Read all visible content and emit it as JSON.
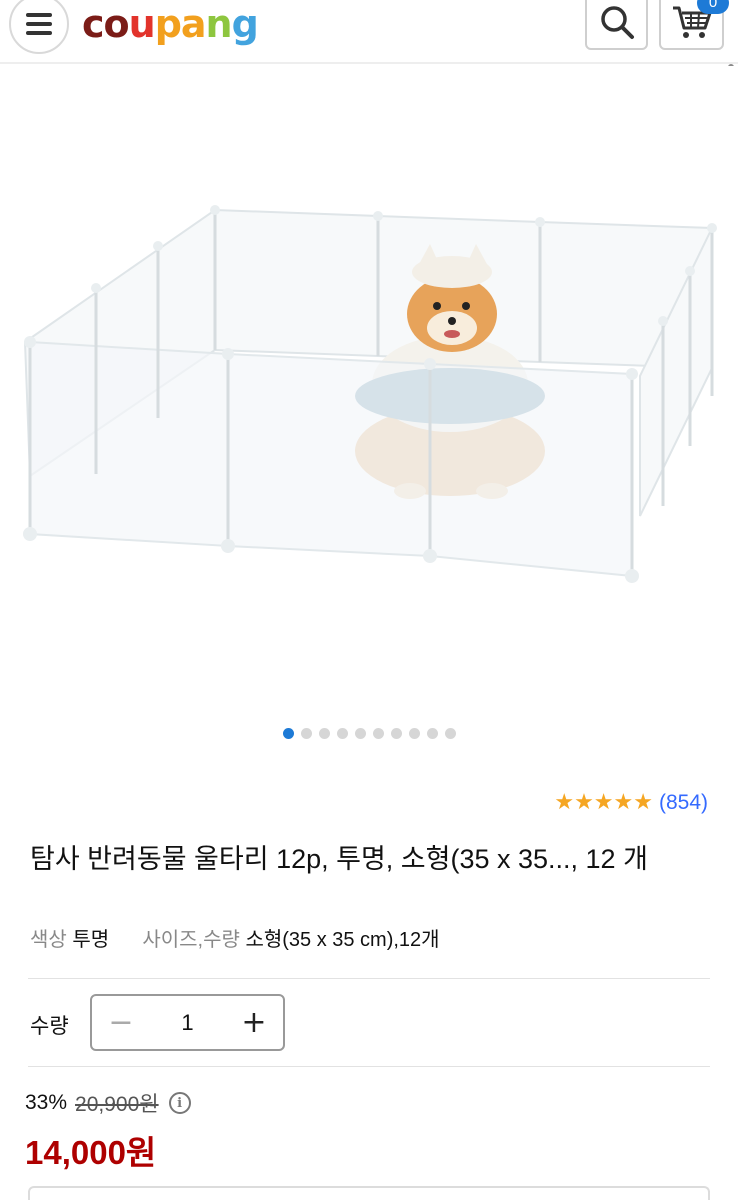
{
  "header": {
    "logo": {
      "c1": "co",
      "c2": "u",
      "c3": "pa",
      "c4": "n",
      "c5": "g"
    },
    "cart_badge": "0",
    "icons": [
      "menu-icon",
      "search-icon",
      "cart-icon"
    ]
  },
  "carousel": {
    "total": 10,
    "active_index": 0
  },
  "rating": {
    "stars": "★★★★★",
    "review_count": "(854)"
  },
  "product": {
    "title": "탐사 반려동물 울타리 12p, 투명, 소형(35 x 35..., 12 개",
    "options": [
      {
        "label": "색상",
        "value": "투명"
      },
      {
        "label": "사이즈,수량",
        "value": "소형(35 x 35 cm),12개"
      }
    ]
  },
  "quantity": {
    "label": "수량",
    "value": "1",
    "minus": "−",
    "plus": "+"
  },
  "price": {
    "discount": "33%",
    "original": "20,900원",
    "sale": "14,000원",
    "info_icon": "i"
  },
  "colors": {
    "accent": "#1d7ad6",
    "sale_price": "#ae0000",
    "star": "#f5a623",
    "review_link": "#346aff"
  }
}
